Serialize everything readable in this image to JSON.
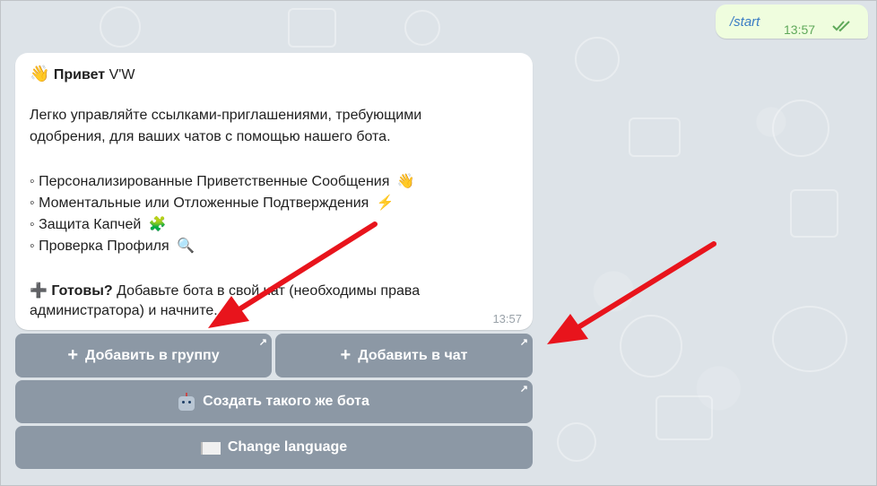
{
  "outgoing": {
    "text": "/start",
    "time": "13:57"
  },
  "incoming": {
    "greeting_bold": "Привет",
    "greeting_name": "V'W",
    "greeting_emoji": "👋",
    "intro_line1": "Легко управляйте ссылками-приглашениями, требующими",
    "intro_line2": "одобрения, для ваших чатов с помощью нашего бота.",
    "features": [
      {
        "text": "◦ Персонализированные Приветственные Сообщения",
        "emoji": "👋"
      },
      {
        "text": "◦ Моментальные или Отложенные Подтверждения",
        "emoji": "⚡"
      },
      {
        "text": "◦ Защита Капчей",
        "emoji": "🧩"
      },
      {
        "text": "◦ Проверка Профиля",
        "emoji": "🔍"
      }
    ],
    "cta_icon": "➕",
    "cta_bold": "Готовы?",
    "cta_text1": "Добавьте бота в свой чат (необходимы права",
    "cta_text2": "администратора) и начните.",
    "time": "13:57"
  },
  "keyboard": {
    "add_group": "Добавить в группу",
    "add_chat": "Добавить в чат",
    "create_bot": "Создать такого же бота",
    "change_language": "Change language",
    "plus_icon": "+",
    "link_arrow": "↗"
  },
  "colors": {
    "annotation_arrow": "#e8141c",
    "button_bg": "#748392",
    "outgoing_bg": "#effdde"
  }
}
